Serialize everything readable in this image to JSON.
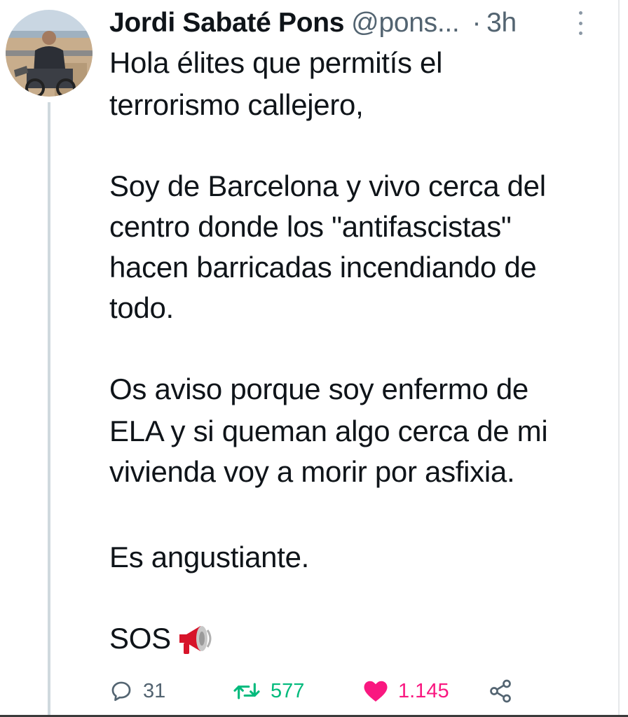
{
  "tweet": {
    "author_name": "Jordi Sabaté Pons",
    "handle": "@pons...",
    "separator": "·",
    "time": "3h",
    "lines": [
      "Hola élites que permitís el",
      "terrorismo callejero,",
      "Soy de Barcelona y vivo cerca del",
      "centro donde los \"antifascistas\"",
      "hacen barricadas incendiando de",
      "todo.",
      "Os aviso porque soy enfermo de",
      "ELA y si queman algo cerca de mi",
      "vivienda voy a morir por asfixia.",
      "Es angustiante.",
      "SOS"
    ],
    "emoji_icon": "megaphone-icon"
  },
  "actions": {
    "replies": "31",
    "retweets": "577",
    "likes": "1.145"
  },
  "colors": {
    "text": "#0f1419",
    "secondary": "#536471",
    "retweet_green": "#00ba7c",
    "like_pink": "#f91880",
    "thread_line": "#cfd9de"
  },
  "icons": {
    "reply": "reply-icon",
    "retweet": "retweet-icon",
    "like": "heart-icon",
    "share": "share-icon",
    "more": "more-options-icon"
  }
}
